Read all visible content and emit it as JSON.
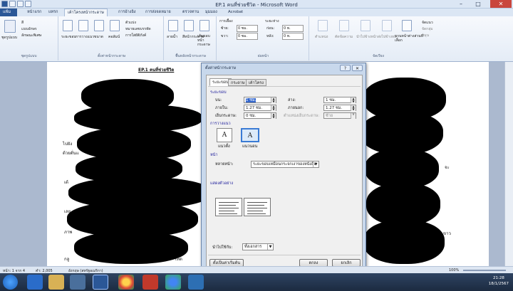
{
  "window": {
    "title": "EP.1 คนที่ช่วยชีวิต - Microsoft Word",
    "minimize": "–",
    "maximize": "□",
    "close": "✕"
  },
  "tabs": [
    {
      "label": "แฟ้ม"
    },
    {
      "label": "หน้าแรก"
    },
    {
      "label": "แทรก"
    },
    {
      "label": "เค้าโครงหน้ากระดาษ"
    },
    {
      "label": "การอ้างอิง"
    },
    {
      "label": "การส่งจดหมาย"
    },
    {
      "label": "ตรวจทาน"
    },
    {
      "label": "มุมมอง"
    },
    {
      "label": "Acrobat"
    }
  ],
  "ribbon": {
    "themes": {
      "label": "ชุดรูปแบบ",
      "btn": "ชุดรูปแบบ",
      "colors": "สี",
      "fonts": "แบบอักษร",
      "effects": "ลักษณะพิเศษ"
    },
    "page_setup": {
      "label": "ตั้งค่าหน้ากระดาษ",
      "margins": "ระยะขอบ",
      "orientation": "การวางแนว",
      "size": "ขนาด",
      "columns": "คอลัมน์",
      "breaks": "ตัวแบ่ง",
      "line_numbers": "หมายเลขบรรทัด",
      "hyphenation": "การใส่ยัติภังค์"
    },
    "background": {
      "label": "พื้นหลังหน้ากระดาษ",
      "watermark": "ลายน้ำ",
      "page_color": "สีหน้ากระดาษ",
      "page_borders": "เส้นขอบหน้ากระดาษ"
    },
    "paragraph": {
      "label": "ย่อหน้า",
      "indent": "การเยื้อง",
      "spacing": "ระยะห่าง",
      "left": "ซ้าย:",
      "right": "ขวา:",
      "before": "ก่อน:",
      "after": "หลัง:",
      "left_val": "0 ซม.",
      "right_val": "0 ซม.",
      "before_val": "0 พ.",
      "after_val": "0 พ."
    },
    "arrange": {
      "label": "จัดเรียง",
      "position": "ตำแหน่ง",
      "wrap": "ตัดข้อความ",
      "bring_forward": "นำไปข้างหน้า",
      "send_backward": "ส่งไปข้างหลัง",
      "selection_pane": "บานหน้าต่างส่วนที่เลือก",
      "align": "จัดแนว",
      "group": "จัดกลุ่ม",
      "rotate": "หมุน"
    }
  },
  "document": {
    "title_line": "EP.1 คนที่ช่วยชีวิต",
    "frag1": "ไปยัง",
    "frag2": "ด้วยดั่นแ",
    "frag3": "เต้",
    "frag4": "เลย",
    "frag5": "ภาพ",
    "frag6": "กลู",
    "frag7": "เท็ด",
    "frag8": "จะ",
    "frag9": "ขาว"
  },
  "dialog": {
    "title": "ตั้งค่าหน้ากระดาษ",
    "help": "?",
    "close": "✕",
    "tabs": [
      "ระยะขอบ",
      "กระดาษ",
      "เค้าโครง"
    ],
    "margins_section": "ระยะขอบ",
    "top_label": "บน:",
    "top_value": "1 ซม.",
    "bottom_label": "ล่าง:",
    "bottom_value": "1 ซม.",
    "inside_label": "ภายใน:",
    "inside_value": "1.27 ซม.",
    "outside_label": "ภายนอก:",
    "outside_value": "1.27 ซม.",
    "gutter_label": "เย็บกระดาษ:",
    "gutter_value": "0 ซม.",
    "gutter_pos_label": "ตำแหน่งเย็บกระดาษ:",
    "gutter_pos_value": "ซ้าย",
    "orientation_section": "การวางแนว",
    "portrait": "แนวตั้ง",
    "landscape": "แนวนอน",
    "pages_section": "หน้า",
    "multiple_pages_label": "หลายหน้า:",
    "multiple_pages_value": "ระยะขอบเหมือนกระจกเงาของหนังสือ",
    "preview_section": "แสดงตัวอย่าง",
    "apply_to_label": "นำไปใช้กับ:",
    "apply_to_value": "ทั้งเอกสาร",
    "default_button": "ตั้งเป็นค่าเริ่มต้น",
    "ok_button": "ตกลง",
    "cancel_button": "ยกเลิก"
  },
  "statusbar": {
    "page": "หน้า: 1 จาก 4",
    "words": "คำ: 2,005",
    "language": "อังกฤษ (สหรัฐอเมริกา)",
    "zoom": "100%"
  },
  "taskbar": {
    "time": "21:28",
    "date": "18/1/2567"
  }
}
